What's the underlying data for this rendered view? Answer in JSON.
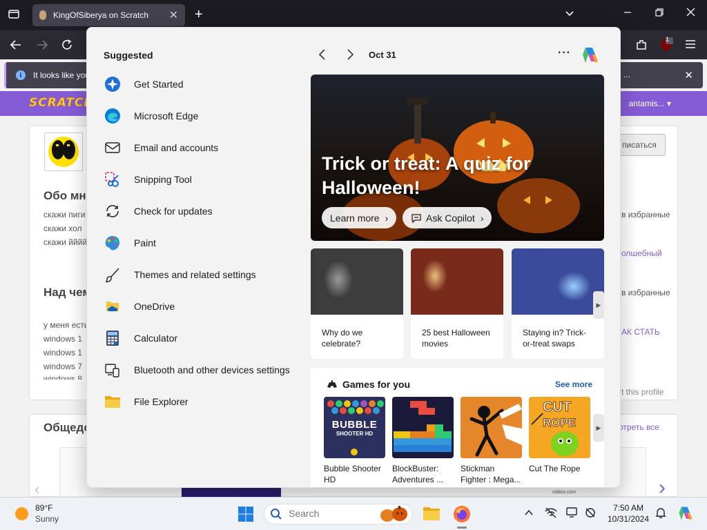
{
  "browser": {
    "tab_title": "KingOfSiberya on Scratch",
    "notification_text": "It looks like you",
    "notification_tail": "...",
    "ext_badge": "1"
  },
  "scratch": {
    "username": "antamis...",
    "follow_label": "писаться",
    "about_heading": "Обо мн",
    "about_lines": [
      "скажи пиги",
      "скажи хол",
      "скажи йййй"
    ],
    "working_heading": "Над чем",
    "working_lines": [
      "у меня есть",
      "windows 1",
      "windows 1",
      "windows 7",
      "windows 8"
    ],
    "right_texts": [
      "в избранные",
      "олшебный",
      "в избранные",
      "АК СТАТЬ"
    ],
    "report_label": "t this profile",
    "studios_heading": "Общедо",
    "view_all": "отреть все",
    "roblox_label": "roblox.com"
  },
  "start_menu": {
    "suggested_title": "Suggested",
    "suggested": [
      {
        "label": "Get Started",
        "icon": "get-started-icon"
      },
      {
        "label": "Microsoft Edge",
        "icon": "edge-icon"
      },
      {
        "label": "Email and accounts",
        "icon": "mail-icon"
      },
      {
        "label": "Snipping Tool",
        "icon": "snipping-tool-icon"
      },
      {
        "label": "Check for updates",
        "icon": "update-icon"
      },
      {
        "label": "Paint",
        "icon": "paint-icon"
      },
      {
        "label": "Themes and related settings",
        "icon": "brush-icon"
      },
      {
        "label": "OneDrive",
        "icon": "onedrive-icon"
      },
      {
        "label": "Calculator",
        "icon": "calculator-icon"
      },
      {
        "label": "Bluetooth and other devices settings",
        "icon": "devices-icon"
      },
      {
        "label": "File Explorer",
        "icon": "folder-icon"
      }
    ],
    "date": "Oct 31",
    "hero": {
      "title": "Trick or treat: A quiz for Halloween!",
      "learn_more": "Learn more",
      "ask_copilot": "Ask Copilot"
    },
    "stories": [
      {
        "caption": "Why do we celebrate?"
      },
      {
        "caption": "25 best Halloween movies"
      },
      {
        "caption": "Staying in? Trick-or-treat swaps"
      }
    ],
    "games": {
      "title": "Games for you",
      "see_more": "See more",
      "items": [
        {
          "name": "Bubble Shooter HD",
          "art": "BUBBLE",
          "art2": "SHOOTER HD"
        },
        {
          "name": "BlockBuster: Adventures ..."
        },
        {
          "name": "Stickman Fighter : Mega..."
        },
        {
          "name": "Cut The Rope",
          "art": "CUT",
          "art2": "ROPE"
        }
      ]
    }
  },
  "taskbar": {
    "temp": "89°F",
    "condition": "Sunny",
    "search_placeholder": "Search",
    "time": "7:50 AM",
    "date": "10/31/2024"
  }
}
